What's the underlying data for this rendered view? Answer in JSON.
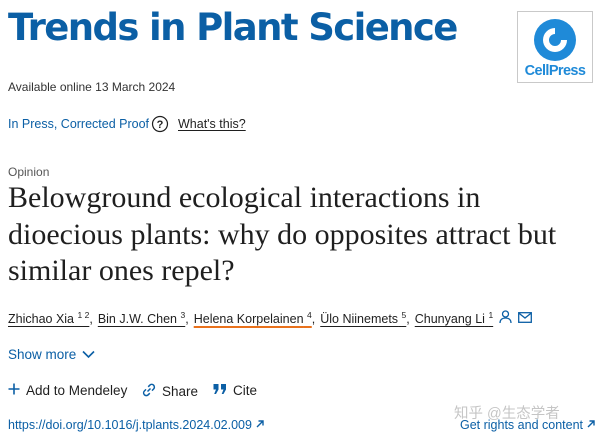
{
  "header": {
    "journal_title": "Trends in Plant Science",
    "logo_text": "CellPress"
  },
  "meta": {
    "available_online": "Available online 13 March 2024",
    "status": "In Press, Corrected Proof",
    "whats_this": "What's this?",
    "article_type": "Opinion"
  },
  "article": {
    "title": "Belowground ecological interactions in dioecious plants: why do opposites attract but similar ones repel?"
  },
  "authors": [
    {
      "name": "Zhichao Xia",
      "affil": "1 2"
    },
    {
      "name": "Bin J.W. Chen",
      "affil": "3"
    },
    {
      "name": "Helena Korpelainen",
      "affil": "4"
    },
    {
      "name": "Ülo Niinemets",
      "affil": "5"
    },
    {
      "name": "Chunyang Li",
      "affil": "1"
    }
  ],
  "show_more": "Show more",
  "actions": {
    "add_mendeley": "Add to Mendeley",
    "share": "Share",
    "cite": "Cite"
  },
  "links": {
    "doi": "https://doi.org/10.1016/j.tplants.2024.02.009",
    "rights": "Get rights and content"
  },
  "watermark": "知乎 @生态学者",
  "icons": [
    "help-icon",
    "person-icon",
    "mail-icon",
    "chevron-down-icon",
    "plus-icon",
    "share-icon",
    "quote-icon",
    "external-link-icon"
  ],
  "colors": {
    "accent": "#0b5fa5",
    "logo": "#1f8ad8",
    "highlight": "#e9711c",
    "text": "#1f1f1f"
  }
}
